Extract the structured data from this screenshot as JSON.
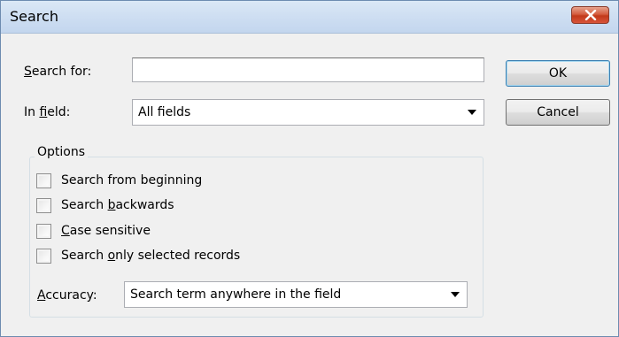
{
  "dialog": {
    "title": "Search"
  },
  "search_for": {
    "label_prefix": "",
    "label_accel": "S",
    "label_rest": "earch for:",
    "value": ""
  },
  "in_field": {
    "label_prefix": "In ",
    "label_accel": "f",
    "label_rest": "ield:",
    "selected": "All fields"
  },
  "buttons": {
    "ok": "OK",
    "cancel": "Cancel"
  },
  "options": {
    "title": "Options",
    "items": [
      {
        "pre": "Search from beginning",
        "accel": "",
        "post": "",
        "checked": false
      },
      {
        "pre": "Search ",
        "accel": "b",
        "post": "ackwards",
        "checked": false
      },
      {
        "pre": "",
        "accel": "C",
        "post": "ase sensitive",
        "checked": false
      },
      {
        "pre": "Search ",
        "accel": "o",
        "post": "nly selected records",
        "checked": false
      }
    ]
  },
  "accuracy": {
    "label_prefix": "",
    "label_accel": "A",
    "label_rest": "ccuracy:",
    "selected": "Search term anywhere in the field"
  },
  "icons": {
    "close": "close-icon",
    "dropdown": "chevron-down-icon"
  },
  "colors": {
    "dialog_bg": "#f0f0f0",
    "close_button": "#c2391a",
    "default_button_border": "#3c7fb1"
  }
}
